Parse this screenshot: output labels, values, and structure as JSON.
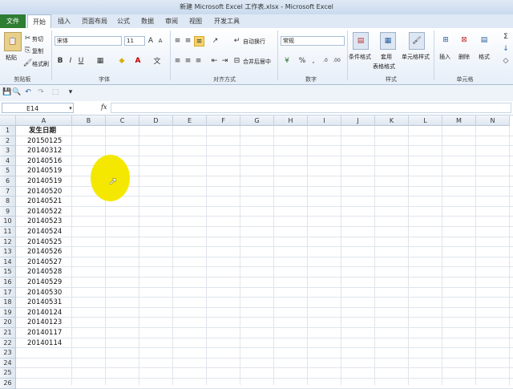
{
  "window": {
    "title": "新建 Microsoft Excel 工作表.xlsx - Microsoft Excel"
  },
  "ribbon_tabs": [
    "开始",
    "插入",
    "页面布局",
    "公式",
    "数据",
    "审阅",
    "视图",
    "开发工具"
  ],
  "file_tab": "文件",
  "clipboard": {
    "paste": "粘贴",
    "cut": "剪切",
    "copy": "复制",
    "format_painter": "格式刷",
    "group": "剪贴板"
  },
  "font": {
    "name": "宋体",
    "size": "11",
    "group": "字体"
  },
  "alignment": {
    "wrap": "自动换行",
    "merge": "合并后居中",
    "group": "对齐方式"
  },
  "number": {
    "format": "常规",
    "group": "数字"
  },
  "styles": {
    "conditional": "条件格式",
    "table": "套用",
    "table2": "表格格式",
    "cell_style": "单元格样式",
    "group": "样式"
  },
  "cells": {
    "insert": "插入",
    "delete": "删除",
    "format": "格式",
    "group": "单元格"
  },
  "formula_bar": {
    "name_box": "E14",
    "fx": "fx",
    "value": ""
  },
  "columns": [
    "A",
    "B",
    "C",
    "D",
    "E",
    "F",
    "G",
    "H",
    "I",
    "J",
    "K",
    "L",
    "M",
    "N"
  ],
  "rows": [
    "1",
    "2",
    "3",
    "4",
    "5",
    "6",
    "7",
    "8",
    "9",
    "10",
    "11",
    "12",
    "13",
    "14",
    "15",
    "16",
    "17",
    "18",
    "19",
    "20",
    "21",
    "22",
    "23",
    "24",
    "25",
    "26"
  ],
  "sheet": {
    "header": "发生日期",
    "values": [
      "20150125",
      "20140312",
      "20140516",
      "20140519",
      "20140519",
      "20140520",
      "20140521",
      "20140522",
      "20140523",
      "20140524",
      "20140525",
      "20140526",
      "20140527",
      "20140528",
      "20140529",
      "20140530",
      "20140531",
      "20140124",
      "20140123",
      "20140117",
      "20140114"
    ]
  },
  "highlight_color": "#f5e800",
  "file_tab_color": "#2e7d32"
}
